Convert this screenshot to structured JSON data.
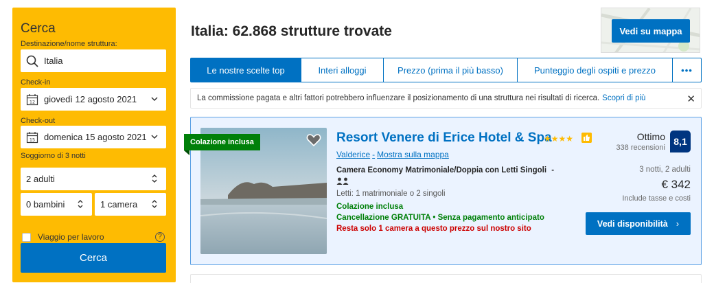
{
  "sidebar": {
    "title": "Cerca",
    "destination_label": "Destinazione/nome struttura:",
    "destination_value": "Italia",
    "checkin_label": "Check-in",
    "checkin_value": "giovedì 12 agosto 2021",
    "checkout_label": "Check-out",
    "checkout_value": "domenica 15 agosto 2021",
    "stay_text": "Soggiorno di 3 notti",
    "adults_value": "2 adulti",
    "children_value": "0 bambini",
    "rooms_value": "1 camera",
    "business_label": "Viaggio per lavoro",
    "help_glyph": "?",
    "search_button": "Cerca",
    "calendar_day_in": "12",
    "calendar_day_out": "15"
  },
  "header": {
    "title": "Italia: 62.868 strutture trovate",
    "map_button": "Vedi su mappa"
  },
  "tabs": [
    {
      "label": "Le nostre scelte top",
      "active": true
    },
    {
      "label": "Interi alloggi",
      "active": false
    },
    {
      "label": "Prezzo (prima il più basso)",
      "active": false
    },
    {
      "label": "Punteggio degli ospiti e prezzo",
      "active": false
    },
    {
      "label": "•••",
      "active": false
    }
  ],
  "notice": {
    "text": "La commissione pagata e altri fattori potrebbero influenzare il posizionamento di una struttura nei risultati di ricerca.",
    "link": "Scopri di più",
    "close": "✕"
  },
  "hotel": {
    "ribbon": "Colazione inclusa",
    "name": "Resort Venere di Erice Hotel & Spa",
    "stars": "★★★★",
    "location": "Valderice",
    "separator": "-",
    "map_link": "Mostra sulla mappa",
    "room_name": "Camera Economy Matrimoniale/Doppia con Letti Singoli",
    "room_dash": "-",
    "beds": "Letti: 1 matrimoniale o 2 singoli",
    "breakfast": "Colazione inclusa",
    "cancellation": "Cancellazione GRATUITA • Senza pagamento anticipato",
    "scarcity": "Resta solo 1 camera a questo prezzo sul nostro sito",
    "score_word": "Ottimo",
    "reviews": "338 recensioni",
    "score": "8,1",
    "stay_info": "3 notti, 2 adulti",
    "price": "€ 342",
    "taxes": "Include tasse e costi",
    "avail_button": "Vedi disponibilità",
    "avail_arrow": "›"
  },
  "colors": {
    "brand_blue": "#0071c2",
    "dark_blue": "#003580",
    "yellow": "#febb02",
    "green": "#008009",
    "red": "#cc0000"
  },
  "icons": {
    "destination": "search-icon",
    "checkin": "calendar-icon",
    "checkout": "calendar-icon",
    "selects": "chevron-icon",
    "favourite": "heart-icon",
    "occupancy": "people-icon",
    "thumb": "thumbs-up-icon"
  }
}
